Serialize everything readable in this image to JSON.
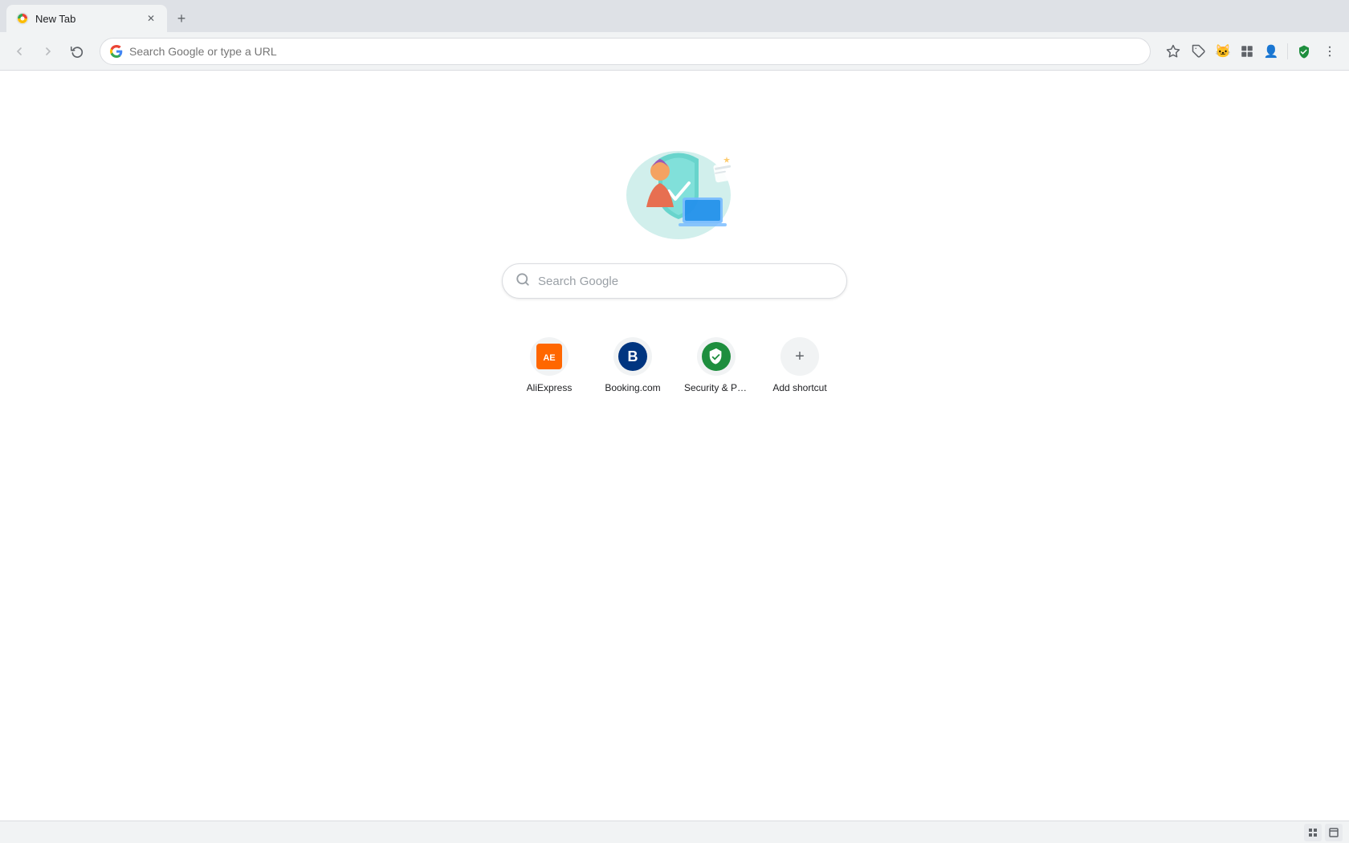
{
  "browser": {
    "tab": {
      "title": "New Tab",
      "favicon": "🌐"
    },
    "new_tab_label": "+",
    "address": {
      "url": "Search Google or type a URL",
      "placeholder": "Search Google or type a URL"
    }
  },
  "toolbar": {
    "back_title": "Back",
    "forward_title": "Forward",
    "reload_title": "Reload",
    "bookmark_title": "Bookmark this tab",
    "extensions_title": "Extensions",
    "menu_title": "Customize and control Google Chrome"
  },
  "page": {
    "search_placeholder": "Search Google",
    "shortcuts": [
      {
        "id": "aliexpress",
        "label": "AliExpress",
        "icon_type": "aliexpress"
      },
      {
        "id": "booking",
        "label": "Booking.com",
        "icon_type": "booking"
      },
      {
        "id": "security",
        "label": "Security & Priv...",
        "icon_type": "security"
      },
      {
        "id": "add",
        "label": "Add shortcut",
        "icon_type": "add"
      }
    ]
  },
  "bottom": {
    "btn1": "⊞",
    "btn2": "⊡"
  }
}
